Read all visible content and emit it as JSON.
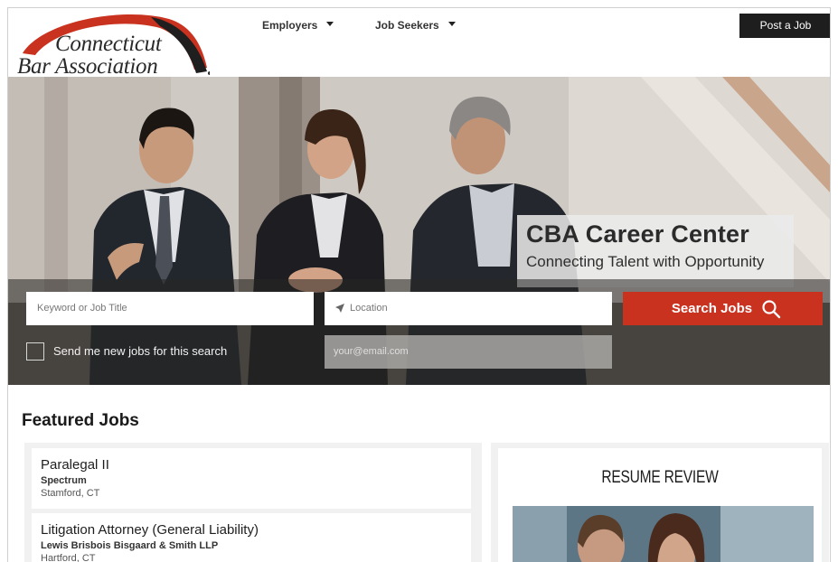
{
  "brand": {
    "logo_line1": "Connecticut",
    "logo_line2": "Bar Association",
    "accent_color": "#c8321f"
  },
  "nav": {
    "items": [
      {
        "label": "Employers",
        "icon": "caret-down-icon"
      },
      {
        "label": "Job Seekers",
        "icon": "caret-down-icon"
      }
    ],
    "post_job": "Post a Job"
  },
  "hero": {
    "title": "CBA Career Center",
    "subtitle": "Connecting Talent with Opportunity"
  },
  "search": {
    "keyword_placeholder": "Keyword or Job Title",
    "location_placeholder": "Location",
    "button_label": "Search Jobs",
    "button_icon": "search-icon",
    "alert_checkbox_label": "Send me new jobs for this search",
    "email_placeholder": "your@email.com"
  },
  "featured": {
    "title": "Featured Jobs",
    "jobs": [
      {
        "title": "Paralegal II",
        "company": "Spectrum",
        "location": "Stamford, CT"
      },
      {
        "title": "Litigation Attorney (General Liability)",
        "company": "Lewis Brisbois Bisgaard & Smith LLP",
        "location": "Hartford, CT"
      }
    ]
  },
  "resume": {
    "title": "RESUME REVIEW"
  }
}
